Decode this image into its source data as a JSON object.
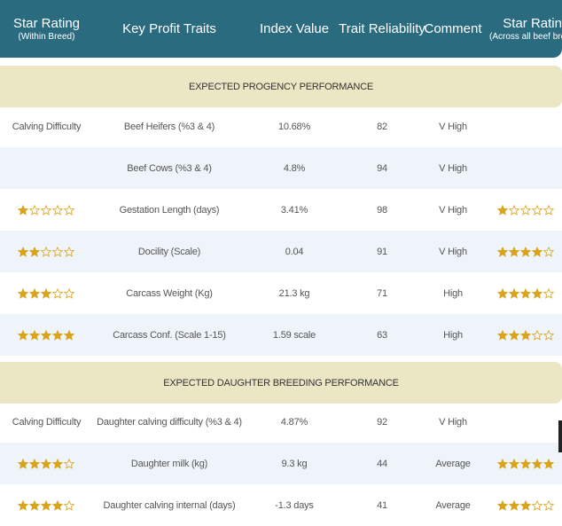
{
  "header": {
    "col1_line1": "Star Rating",
    "col1_line2": "(Within Breed)",
    "col2": "Key Profit Traits",
    "col3": "Index Value",
    "col4": "Trait Reliability",
    "col5": "Comment",
    "col6_line1": "Star Rating",
    "col6_line2": "(Across all beef breeds)"
  },
  "colors": {
    "header_bg": "#2b6b80",
    "section_bg": "#ebe6c4",
    "alt_row_bg": "#eef4fa",
    "star_fill": "#d9a31a"
  },
  "sections": [
    {
      "title": "EXPECTED PROGENCY PERFORMANCE",
      "rows": [
        {
          "label": "Calving Difficulty",
          "stars_within": null,
          "trait": "Beef Heifers (%3 & 4)",
          "index": "10.68%",
          "reliability": "82",
          "comment": "V High",
          "stars_across": null
        },
        {
          "label": "",
          "stars_within": null,
          "trait": "Beef Cows (%3 & 4)",
          "index": "4.8%",
          "reliability": "94",
          "comment": "V High",
          "stars_across": null
        },
        {
          "label": "",
          "stars_within": 1,
          "trait": "Gestation Length (days)",
          "index": "3.41%",
          "reliability": "98",
          "comment": "V High",
          "stars_across": 1
        },
        {
          "label": "",
          "stars_within": 2,
          "trait": "Docility (Scale)",
          "index": "0.04",
          "reliability": "91",
          "comment": "V High",
          "stars_across": 4
        },
        {
          "label": "",
          "stars_within": 3,
          "trait": "Carcass Weight (Kg)",
          "index": "21.3 kg",
          "reliability": "71",
          "comment": "High",
          "stars_across": 4
        },
        {
          "label": "",
          "stars_within": 5,
          "trait": "Carcass Conf. (Scale 1-15)",
          "index": "1.59 scale",
          "reliability": "63",
          "comment": "High",
          "stars_across": 3
        }
      ]
    },
    {
      "title": "EXPECTED DAUGHTER BREEDING PERFORMANCE",
      "rows": [
        {
          "label": "Calving Difficulty",
          "stars_within": null,
          "trait": "Daughter calving difficulty (%3 & 4)",
          "index": "4.87%",
          "reliability": "92",
          "comment": "V High",
          "stars_across": null
        },
        {
          "label": "",
          "stars_within": 4,
          "trait": "Daughter milk (kg)",
          "index": "9.3 kg",
          "reliability": "44",
          "comment": "Average",
          "stars_across": 5
        },
        {
          "label": "",
          "stars_within": 4,
          "trait": "Daughter calving internal (days)",
          "index": "-1.3 days",
          "reliability": "41",
          "comment": "Average",
          "stars_across": 3
        }
      ]
    }
  ]
}
